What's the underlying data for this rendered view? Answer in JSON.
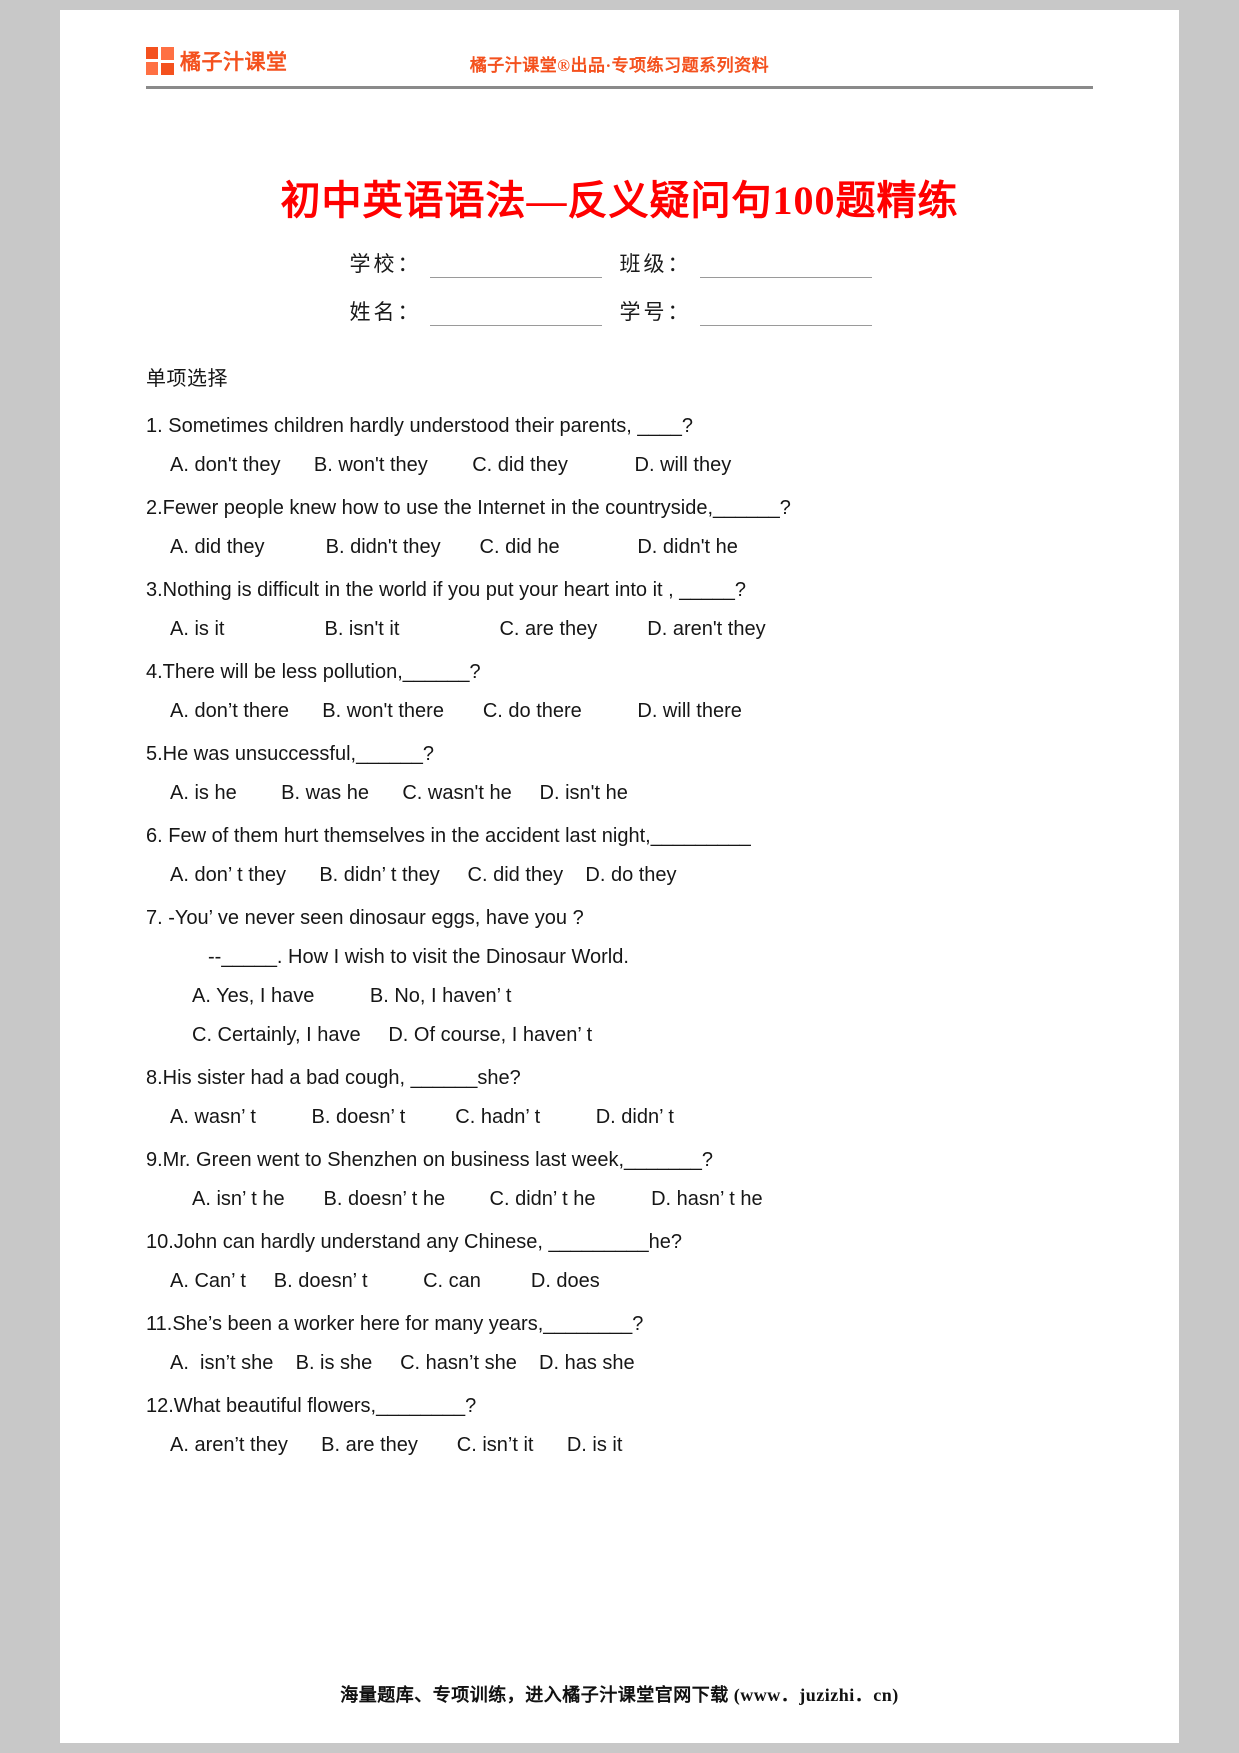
{
  "header": {
    "logo_text": "橘子汁课堂",
    "slogan": "橘子汁课堂®出品·专项练习题系列资料"
  },
  "title": "初中英语语法—反义疑问句100题精练",
  "form": {
    "school_label": "学校：",
    "class_label": "班级：",
    "name_label": "姓名：",
    "student_id_label": "学号："
  },
  "section_heading": "单项选择",
  "questions": [
    {
      "stem": "1. Sometimes children hardly understood their parents, ____?",
      "options": "A. don't they      B. won't they        C. did they            D. will they"
    },
    {
      "stem": "2.Fewer people knew how to use the Internet in the countryside,______?",
      "options": "A. did they           B. didn't they       C. did he              D. didn't he"
    },
    {
      "stem": "3.Nothing is difficult in the world if you put your heart into it , _____?",
      "options": "A. is it                  B. isn't it                  C. are they         D. aren't they"
    },
    {
      "stem": "4.There will be less pollution,______?",
      "options": "A. don’t there      B. won't there       C. do there          D. will there"
    },
    {
      "stem": "5.He was unsuccessful,______?",
      "options": "A. is he        B. was he      C. wasn't he     D. isn't he"
    },
    {
      "stem": "6. Few of them hurt themselves in the accident last night,_________",
      "options": "A. don’ t they      B. didn’ t they     C. did they    D. do they"
    },
    {
      "stem": "7. -You’ ve never seen dinosaur eggs, have you ?",
      "sub": "--_____. How I wish to visit the Dinosaur World.",
      "options": "A. Yes, I have          B. No, I haven’ t",
      "options2": "C. Certainly, I have     D. Of course, I haven’ t"
    },
    {
      "stem": "8.His sister had a bad cough, ______she?",
      "options": "A. wasn’ t          B. doesn’ t         C. hadn’ t          D. didn’ t"
    },
    {
      "stem": "9.Mr. Green went to Shenzhen on business last week,_______?",
      "options": "A. isn’ t he       B. doesn’ t he        C. didn’ t he          D. hasn’ t he"
    },
    {
      "stem": "10.John can hardly understand any Chinese, _________he?",
      "options": "A. Can’ t     B. doesn’ t          C. can         D. does"
    },
    {
      "stem": "11.She’s been a worker here for many years,________?",
      "options": "A.  isn’t she    B. is she     C. hasn’t she    D. has she"
    },
    {
      "stem": "12.What beautiful flowers,________?",
      "options": "A. aren’t they      B. are they       C. isn’t it      D. is it"
    }
  ],
  "footer": "海量题库、专项训练，进入橘子汁课堂官网下载 (www．juzizhi．cn)"
}
